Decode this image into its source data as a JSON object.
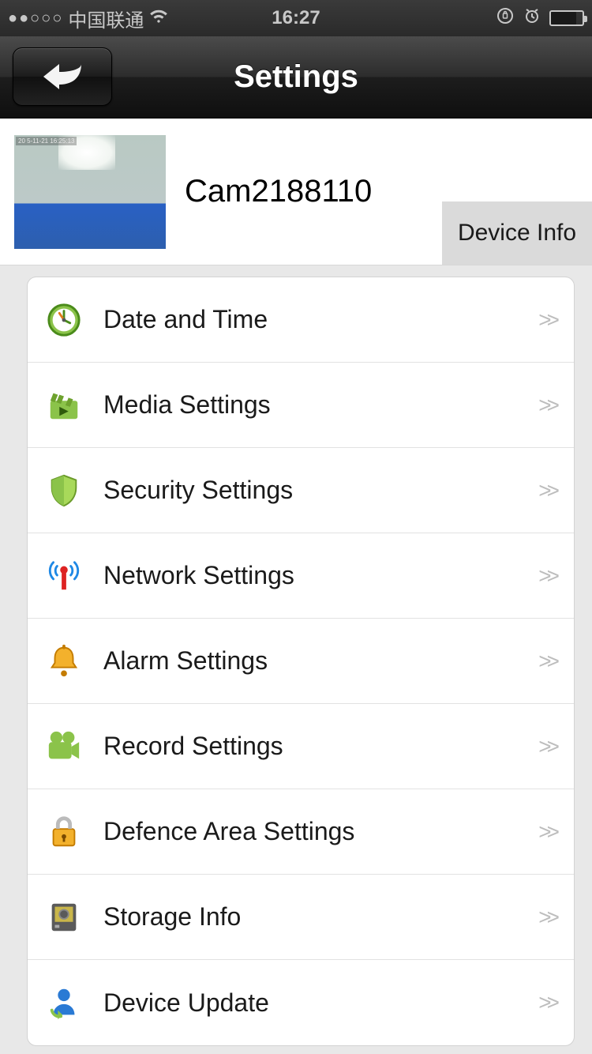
{
  "status_bar": {
    "signal_dots": "●●○○○",
    "carrier": "中国联通",
    "time": "16:27"
  },
  "nav": {
    "title": "Settings"
  },
  "camera": {
    "name": "Cam2188110",
    "device_info_label": "Device Info",
    "thumb_overlay": "20 5-11-21 16:25:13"
  },
  "settings": {
    "items": [
      {
        "label": "Date and Time",
        "icon": "clock"
      },
      {
        "label": "Media Settings",
        "icon": "clapper"
      },
      {
        "label": "Security Settings",
        "icon": "shield"
      },
      {
        "label": "Network Settings",
        "icon": "antenna"
      },
      {
        "label": "Alarm Settings",
        "icon": "bell"
      },
      {
        "label": "Record Settings",
        "icon": "camcorder"
      },
      {
        "label": "Defence Area Settings",
        "icon": "lock"
      },
      {
        "label": "Storage Info",
        "icon": "disk"
      },
      {
        "label": "Device Update",
        "icon": "user-refresh"
      }
    ],
    "chevron": ">>"
  }
}
